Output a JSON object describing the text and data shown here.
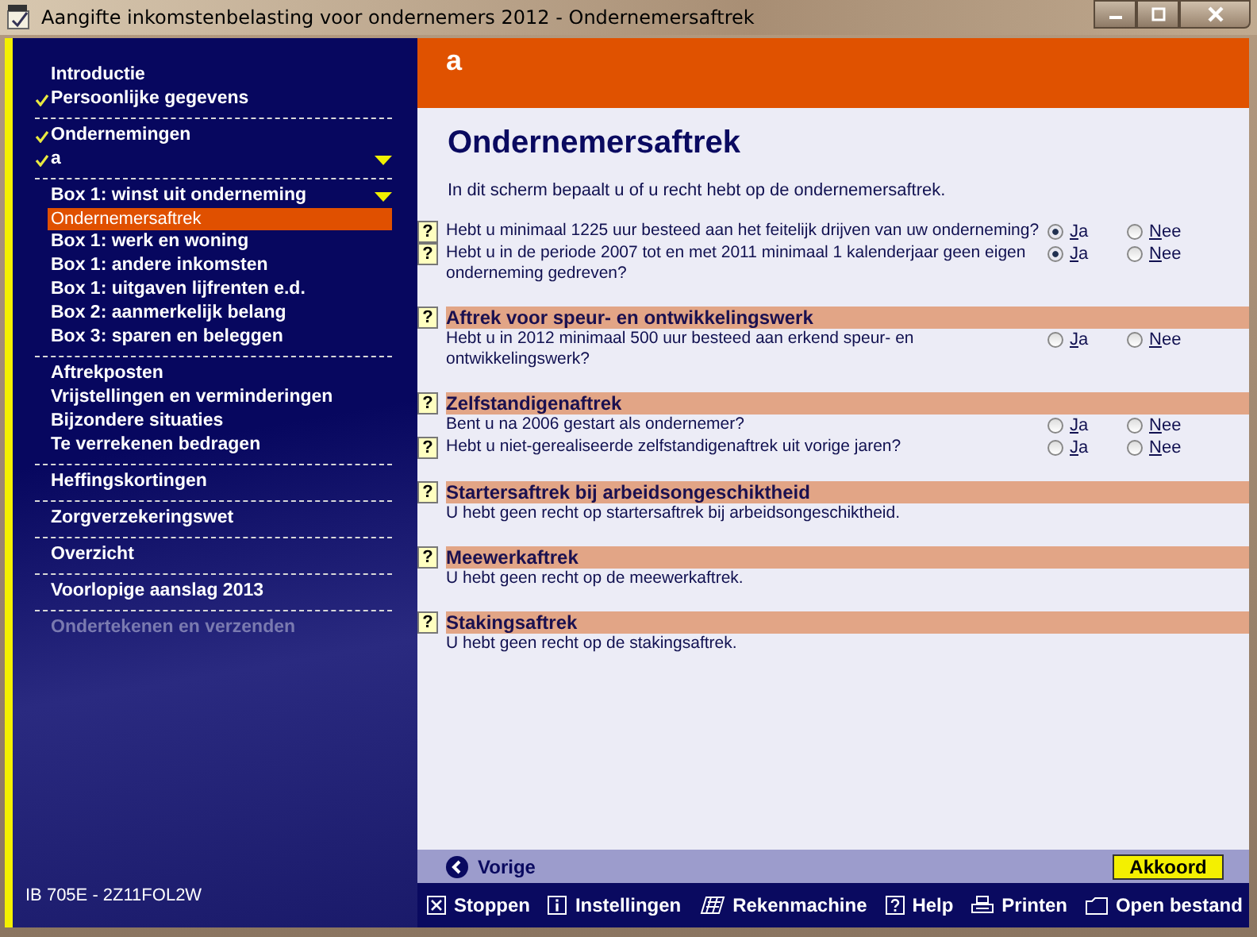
{
  "window": {
    "title": "Aangifte inkomstenbelasting voor ondernemers 2012 - Ondernemersaftrek"
  },
  "sidebar": {
    "groups": [
      {
        "items": [
          {
            "label": "Introductie",
            "checked": false,
            "dropdown": false,
            "selected": false,
            "disabled": false
          },
          {
            "label": "Persoonlijke gegevens",
            "checked": true,
            "dropdown": false,
            "selected": false,
            "disabled": false
          }
        ]
      },
      {
        "items": [
          {
            "label": "Ondernemingen",
            "checked": true,
            "dropdown": false,
            "selected": false,
            "disabled": false
          },
          {
            "label": "a",
            "checked": true,
            "dropdown": true,
            "selected": false,
            "disabled": false
          }
        ]
      },
      {
        "items": [
          {
            "label": "Box 1: winst uit onderneming",
            "checked": false,
            "dropdown": true,
            "selected": false,
            "disabled": false,
            "children": [
              {
                "label": "Ondernemersaftrek",
                "checked": false,
                "dropdown": false,
                "selected": true,
                "disabled": false
              }
            ]
          },
          {
            "label": "Box 1: werk en woning",
            "checked": false,
            "dropdown": false,
            "selected": false,
            "disabled": false
          },
          {
            "label": "Box 1: andere inkomsten",
            "checked": false,
            "dropdown": false,
            "selected": false,
            "disabled": false
          },
          {
            "label": "Box 1: uitgaven lijfrenten e.d.",
            "checked": false,
            "dropdown": false,
            "selected": false,
            "disabled": false
          },
          {
            "label": "Box 2: aanmerkelijk belang",
            "checked": false,
            "dropdown": false,
            "selected": false,
            "disabled": false
          },
          {
            "label": "Box 3: sparen en beleggen",
            "checked": false,
            "dropdown": false,
            "selected": false,
            "disabled": false
          }
        ]
      },
      {
        "items": [
          {
            "label": "Aftrekposten",
            "checked": false,
            "dropdown": false,
            "selected": false,
            "disabled": false
          },
          {
            "label": "Vrijstellingen en verminderingen",
            "checked": false,
            "dropdown": false,
            "selected": false,
            "disabled": false
          },
          {
            "label": "Bijzondere situaties",
            "checked": false,
            "dropdown": false,
            "selected": false,
            "disabled": false
          },
          {
            "label": "Te verrekenen bedragen",
            "checked": false,
            "dropdown": false,
            "selected": false,
            "disabled": false
          }
        ]
      },
      {
        "items": [
          {
            "label": "Heffingskortingen",
            "checked": false,
            "dropdown": false,
            "selected": false,
            "disabled": false
          }
        ]
      },
      {
        "items": [
          {
            "label": "Zorgverzekeringswet",
            "checked": false,
            "dropdown": false,
            "selected": false,
            "disabled": false
          }
        ]
      },
      {
        "items": [
          {
            "label": "Overzicht",
            "checked": false,
            "dropdown": false,
            "selected": false,
            "disabled": false
          }
        ]
      },
      {
        "items": [
          {
            "label": "Voorlopige aanslag 2013",
            "checked": false,
            "dropdown": false,
            "selected": false,
            "disabled": false
          }
        ]
      },
      {
        "items": [
          {
            "label": "Ondertekenen en verzenden",
            "checked": false,
            "dropdown": false,
            "selected": false,
            "disabled": true
          }
        ]
      }
    ],
    "footer": "IB 705E - 2Z11FOL2W"
  },
  "header": {
    "title": "a"
  },
  "page": {
    "title": "Ondernemersaftrek",
    "intro": "In dit scherm bepaalt u of u recht hebt op de ondernemersaftrek.",
    "sections": [
      {
        "items": [
          {
            "kind": "question",
            "help": "?",
            "text": "Hebt u minimaal 1225 uur besteed aan het feitelijk drijven van uw onderneming?",
            "options": [
              {
                "label": "Ja",
                "selected": true
              },
              {
                "label": "Nee",
                "selected": false
              }
            ]
          },
          {
            "kind": "question",
            "help": "?",
            "text": "Hebt u in de periode 2007 tot en met 2011 minimaal 1 kalenderjaar geen eigen onderneming gedreven?",
            "options": [
              {
                "label": "Ja",
                "selected": true
              },
              {
                "label": "Nee",
                "selected": false
              }
            ]
          }
        ]
      },
      {
        "heading": "Aftrek voor speur- en ontwikkelingswerk",
        "help": "?",
        "items": [
          {
            "kind": "question",
            "text": "Hebt u in 2012 minimaal 500 uur besteed aan erkend speur- en ontwikkelingswerk?",
            "options": [
              {
                "label": "Ja",
                "selected": false
              },
              {
                "label": "Nee",
                "selected": false
              }
            ]
          }
        ]
      },
      {
        "heading": "Zelfstandigenaftrek",
        "help": "?",
        "items": [
          {
            "kind": "question",
            "text": "Bent u na 2006 gestart als ondernemer?",
            "options": [
              {
                "label": "Ja",
                "selected": false
              },
              {
                "label": "Nee",
                "selected": false
              }
            ]
          },
          {
            "kind": "question",
            "help": "?",
            "text": "Hebt u niet-gerealiseerde zelfstandigenaftrek uit vorige jaren?",
            "options": [
              {
                "label": "Ja",
                "selected": false
              },
              {
                "label": "Nee",
                "selected": false
              }
            ]
          }
        ]
      },
      {
        "heading": "Startersaftrek bij arbeidsongeschiktheid",
        "help": "?",
        "items": [
          {
            "kind": "note",
            "text": "U hebt geen recht op startersaftrek bij arbeidsongeschiktheid."
          }
        ]
      },
      {
        "heading": "Meewerkaftrek",
        "help": "?",
        "items": [
          {
            "kind": "note",
            "text": "U hebt geen recht op de meewerkaftrek."
          }
        ]
      },
      {
        "heading": "Stakingsaftrek",
        "help": "?",
        "items": [
          {
            "kind": "note",
            "text": "U hebt geen recht op de stakingsaftrek."
          }
        ]
      }
    ]
  },
  "nav": {
    "back": "Vorige",
    "confirm": "Akkoord"
  },
  "toolbar": [
    {
      "kind": "stop",
      "label": "Stoppen"
    },
    {
      "kind": "info",
      "label": "Instellingen"
    },
    {
      "kind": "calculator",
      "label": "Rekenmachine"
    },
    {
      "kind": "help",
      "label": "Help"
    },
    {
      "kind": "print",
      "label": "Printen"
    },
    {
      "kind": "open",
      "label": "Open bestand"
    }
  ]
}
